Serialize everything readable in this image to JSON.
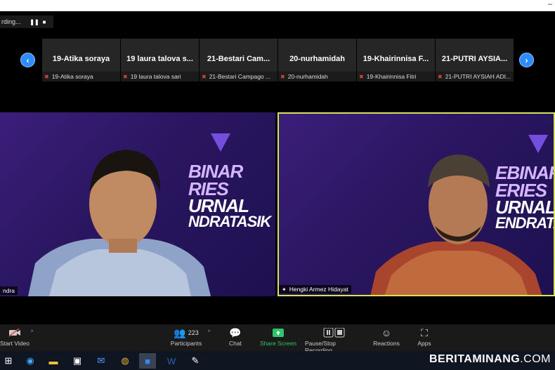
{
  "recording": {
    "label": "rding...",
    "pause_icon": "pause-icon",
    "stop_icon": "stop-icon"
  },
  "strip": {
    "tiles": [
      {
        "name": "19-Atika soraya",
        "label": "19-Atika soraya"
      },
      {
        "name": "19 laura talova s...",
        "label": "19 laura talova sari"
      },
      {
        "name": "21-Bestari Cam...",
        "label": "21-Bestari Campago ..."
      },
      {
        "name": "20-nurhamidah",
        "label": "20-nurhamidah"
      },
      {
        "name": "19-Khairinnisa F...",
        "label": "19-Khairinnisa Fitri"
      },
      {
        "name": "21-PUTRI AYSIA...",
        "label": "21-PUTRI AYSIAH ADI..."
      }
    ],
    "left_arrow": "‹",
    "right_arrow": "›"
  },
  "videos": {
    "left": {
      "name": "ndra",
      "bg_line1": "BINAR",
      "bg_line2": "RIES",
      "bg_line3": "URNAL",
      "bg_line4": "NDRATASIK"
    },
    "right": {
      "name": "Hengki Armez Hidayat",
      "bg_line1": "EBINAR",
      "bg_line2": "ERIES",
      "bg_line3": "URNAL",
      "bg_line4": "ENDRATAS"
    }
  },
  "toolbar": {
    "start_video": "Start Video",
    "participants": "Participants",
    "participants_count": "223",
    "chat": "Chat",
    "share_screen": "Share Screen",
    "recording": "Pause/Stop Recording",
    "reactions": "Reactions",
    "apps": "Apps"
  },
  "watermark": {
    "brand": "BERITAMINANG",
    "tld": ".COM"
  },
  "colors": {
    "accent": "#2d8cff",
    "active_speaker": "#d7e35a",
    "share": "#2ec66a"
  }
}
